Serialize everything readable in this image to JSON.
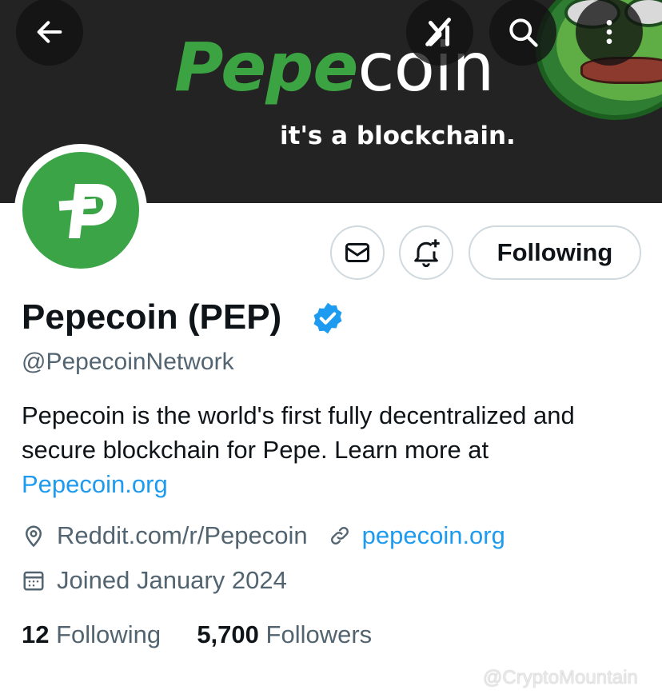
{
  "banner": {
    "title_part1": "Pepe",
    "title_part2": "coin",
    "tagline": "it's a blockchain.",
    "accent_color": "#3ba342"
  },
  "nav": {
    "back_icon": "arrow-left-icon",
    "grok_icon": "grok-icon",
    "search_icon": "search-icon",
    "more_icon": "more-vertical-icon"
  },
  "profile": {
    "display_name": "Pepecoin (PEP)",
    "verified_icon": "verified-badge-icon",
    "handle": "@PepecoinNetwork",
    "bio_text": "Pepecoin is the world's first fully decentralized and secure blockchain for Pepe.  Learn more at",
    "bio_link": "Pepecoin.org",
    "location": "Reddit.com/r/Pepecoin",
    "website": "pepecoin.org",
    "joined": "Joined January 2024",
    "following_count": "12",
    "following_label": "Following",
    "followers_count": "5,700",
    "followers_label": "Followers"
  },
  "actions": {
    "message_icon": "envelope-icon",
    "notify_icon": "bell-plus-icon",
    "follow_label": "Following"
  },
  "watermark": "@CryptoMountain",
  "colors": {
    "link": "#1d9bf0",
    "secondary_text": "#536471",
    "avatar_green": "#3aa447",
    "banner_bg": "#232323"
  }
}
